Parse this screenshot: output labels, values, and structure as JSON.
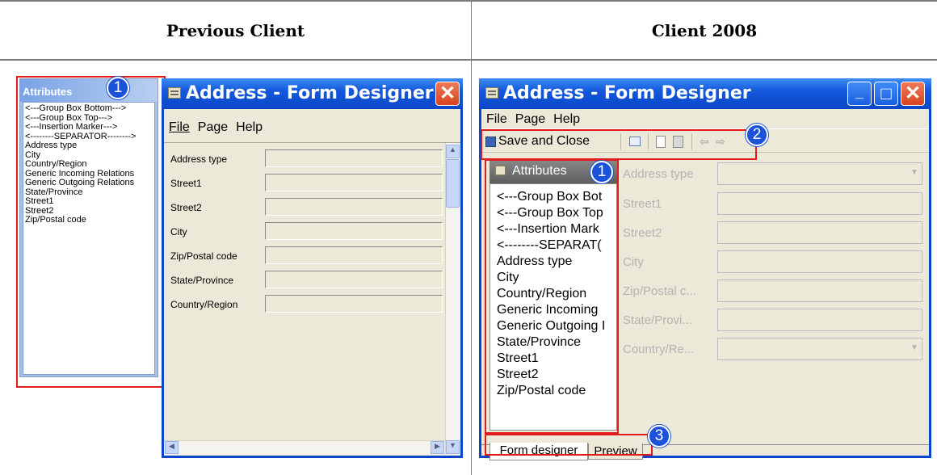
{
  "columns": {
    "left": "Previous Client",
    "right": "Client 2008"
  },
  "left_panel": {
    "attributes_title": "Attributes",
    "badge": "1",
    "items": [
      "<---Group Box Bottom--->",
      "<---Group Box Top--->",
      "<---Insertion Marker--->",
      "<--------SEPARATOR-------->",
      "Address type",
      "City",
      "Country/Region",
      "Generic Incoming Relations",
      "Generic Outgoing Relations",
      "State/Province",
      "Street1",
      "Street2",
      "Zip/Postal code"
    ]
  },
  "left_window": {
    "title": "Address - Form Designer",
    "close_glyph": "✕",
    "menu": [
      "File",
      "Page",
      "Help"
    ],
    "fields": [
      "Address type",
      "Street1",
      "Street2",
      "City",
      "Zip/Postal code",
      "State/Province",
      "Country/Region"
    ]
  },
  "right_window": {
    "title": "Address - Form Designer",
    "minimize_glyph": "_",
    "maximize_glyph": "□",
    "close_glyph": "✕",
    "menu": [
      "File",
      "Page",
      "Help"
    ],
    "toolbar": {
      "save_close": "Save and Close",
      "badge": "2"
    },
    "attributes_title": "Attributes",
    "attributes_badge": "1",
    "attributes_items": [
      "<---Group Box Bot",
      "<---Group Box Top",
      "<---Insertion Mark",
      "<--------SEPARAT(",
      "Address type",
      "City",
      "Country/Region",
      "Generic Incoming",
      "Generic Outgoing I",
      "State/Province",
      "Street1",
      "Street2",
      "Zip/Postal code"
    ],
    "fields": [
      "Address type",
      "Street1",
      "Street2",
      "City",
      "Zip/Postal c...",
      "State/Provi...",
      "Country/Re..."
    ],
    "tabs": [
      "Form designer",
      "Preview"
    ],
    "tabs_badge": "3"
  },
  "colors": {
    "xp_blue": "#0a47c8",
    "highlight_red": "#e21a1a",
    "badge_blue": "#1b52d9",
    "panel_gray": "#ece9d8"
  }
}
